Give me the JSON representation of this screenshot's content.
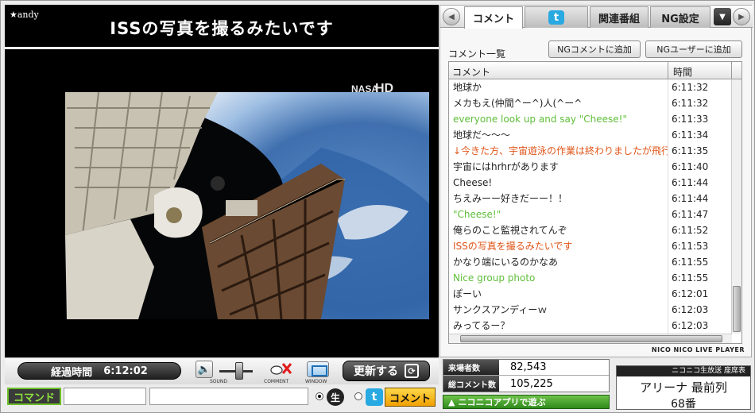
{
  "telop": {
    "user": "★andy",
    "title": "ISSの写真を撮るみたいです"
  },
  "controls": {
    "elapsed_label": "経過時間",
    "elapsed_time": "6:12:02",
    "sound_caption": "SOUND",
    "comment_caption": "COMMENT",
    "window_caption": "WINDOW",
    "refresh_label": "更新する"
  },
  "input": {
    "command_label": "コマンド",
    "command_value": "",
    "comment_value": "",
    "nama_label": "生",
    "submit_label": "コメント"
  },
  "tabs": [
    {
      "label": "コメント"
    },
    {
      "label": ""
    },
    {
      "label": "関連番組"
    },
    {
      "label": "NG設定"
    }
  ],
  "panel": {
    "list_title": "コメント一覧",
    "ng_comment_button": "NGコメントに追加",
    "ng_user_button": "NGユーザーに追加",
    "col_comment": "コメント",
    "col_time": "時間",
    "brand": "NICO NICO LIVE PLAYER"
  },
  "comments": [
    {
      "text": "地球か",
      "time": "6:11:32",
      "color": "#222222"
    },
    {
      "text": "メカもえ(仲間^ー^)人(^ー^",
      "time": "6:11:32",
      "color": "#222222"
    },
    {
      "text": "everyone look up and say \"Cheese!\"",
      "time": "6:11:33",
      "color": "#5fbf3a"
    },
    {
      "text": "地球だ〜〜〜",
      "time": "6:11:34",
      "color": "#222222"
    },
    {
      "text": "↓今きた方、宇宙遊泳の作業は終わりましたが飛行士",
      "time": "6:11:35",
      "color": "#e0561a"
    },
    {
      "text": "宇宙にはhrhrがあります",
      "time": "6:11:40",
      "color": "#222222"
    },
    {
      "text": "Cheese!",
      "time": "6:11:44",
      "color": "#222222"
    },
    {
      "text": "ちえみーー好きだーー！！",
      "time": "6:11:44",
      "color": "#222222"
    },
    {
      "text": "\"Cheese!\"",
      "time": "6:11:47",
      "color": "#5fbf3a"
    },
    {
      "text": "俺らのこと監視されてんぞ",
      "time": "6:11:52",
      "color": "#222222"
    },
    {
      "text": "ISSの写真を撮るみたいです",
      "time": "6:11:53",
      "color": "#e0561a"
    },
    {
      "text": "かなり端にいるのかなあ",
      "time": "6:11:55",
      "color": "#222222"
    },
    {
      "text": "Nice group photo",
      "time": "6:11:55",
      "color": "#5fbf3a"
    },
    {
      "text": "ぽーい",
      "time": "6:12:01",
      "color": "#222222"
    },
    {
      "text": "サンクスアンディーｗ",
      "time": "6:12:03",
      "color": "#222222"
    },
    {
      "text": "みってるー？",
      "time": "6:12:03",
      "color": "#222222"
    }
  ],
  "stats": {
    "visitors_label": "来場者数",
    "visitors_value": "82,543",
    "comments_label": "総コメント数",
    "comments_value": "105,225"
  },
  "app_link": "ニコニコアプリで遊ぶ",
  "seat": {
    "header": "ニコニコ生放送 座席表",
    "arena": "アリーナ 最前列",
    "number": "68番"
  },
  "video": {
    "watermark": "HD"
  }
}
